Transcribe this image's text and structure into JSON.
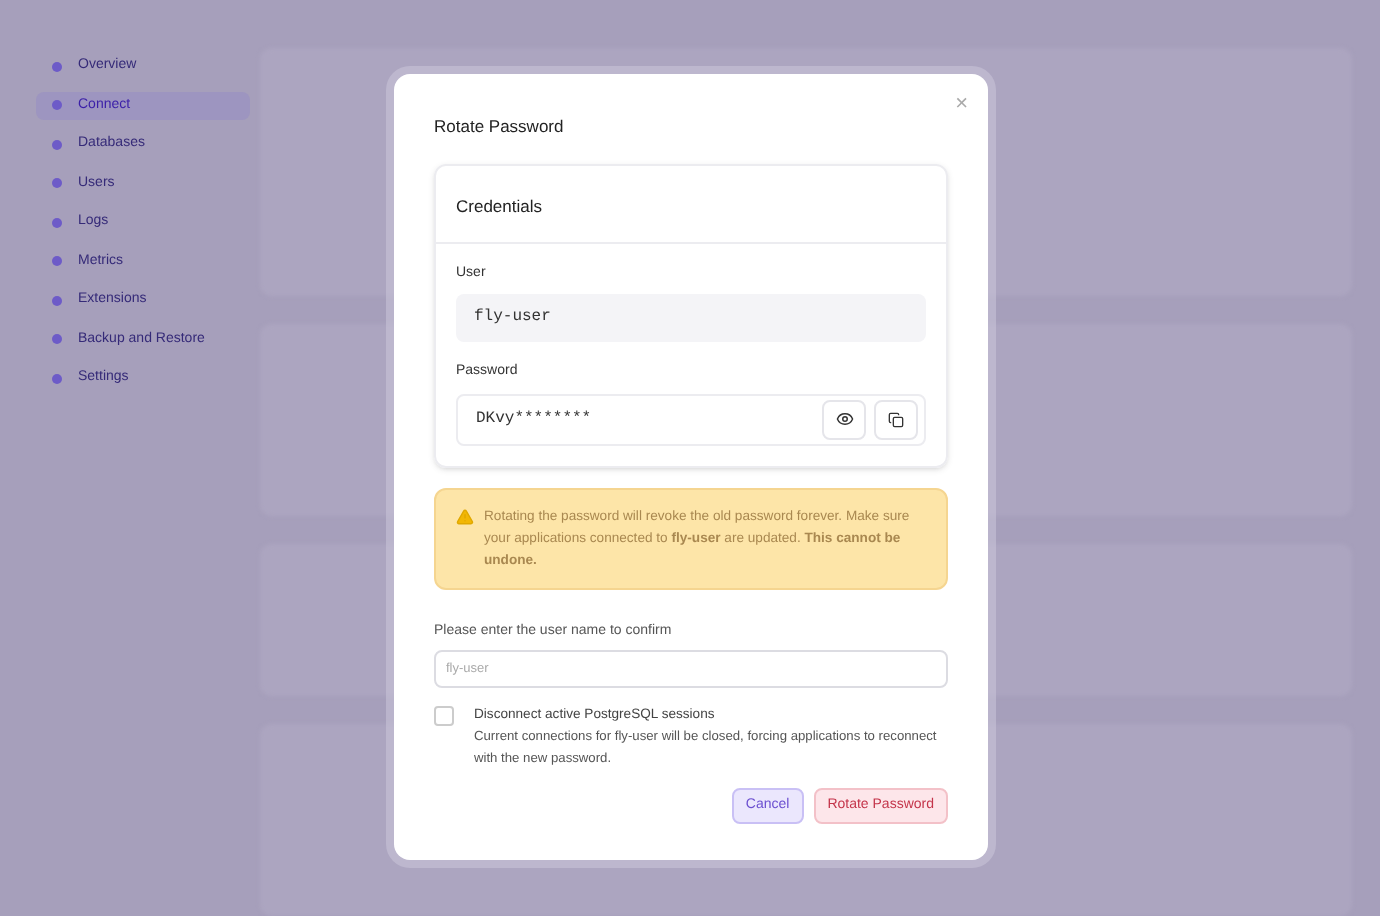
{
  "sidebar": {
    "items": [
      {
        "label": "Overview",
        "selected": false
      },
      {
        "label": "Connect",
        "selected": true
      },
      {
        "label": "Databases",
        "selected": false
      },
      {
        "label": "Users",
        "selected": false
      },
      {
        "label": "Logs",
        "selected": false
      },
      {
        "label": "Metrics",
        "selected": false
      },
      {
        "label": "Extensions",
        "selected": false
      },
      {
        "label": "Backup and Restore",
        "selected": false
      },
      {
        "label": "Settings",
        "selected": false
      }
    ]
  },
  "dialog": {
    "title": "Rotate Password",
    "close": "×",
    "credentials": {
      "title": "Credentials",
      "user_label": "User",
      "user_value": "fly-user",
      "password_label": "Password",
      "password_value": "DKvy********"
    },
    "warning": "Rotating the password will revoke the old password forever. Make sure your applications connected to **fly-user** are updated. **This cannot be undone.**",
    "confirm": {
      "label": "Please enter the user name to confirm",
      "placeholder": "fly-user"
    },
    "disconnect": {
      "checked": false,
      "title": "Disconnect active PostgreSQL sessions",
      "description": "Current connections for fly-user will be closed, forcing applications to reconnect with the new password."
    },
    "buttons": {
      "cancel": "Cancel",
      "confirm": "Rotate Password"
    }
  }
}
